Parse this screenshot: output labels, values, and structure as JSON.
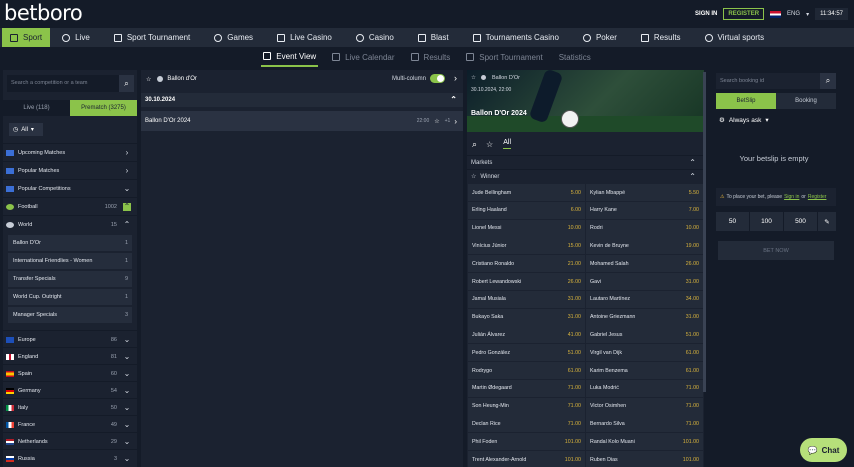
{
  "header": {
    "logo": "betboro",
    "sign_in": "SIGN IN",
    "register": "REGISTER",
    "lang": "ENG",
    "time": "11:34:57"
  },
  "nav": [
    {
      "label": "Sport",
      "icon": "sport-icon"
    },
    {
      "label": "Live",
      "icon": "live-icon"
    },
    {
      "label": "Sport Tournament",
      "icon": "trophy-icon"
    },
    {
      "label": "Games",
      "icon": "games-icon"
    },
    {
      "label": "Live Casino",
      "icon": "casino-icon"
    },
    {
      "label": "Casino",
      "icon": "casino-chip-icon"
    },
    {
      "label": "Blast",
      "icon": "blast-icon"
    },
    {
      "label": "Tournaments Casino",
      "icon": "tournament-icon"
    },
    {
      "label": "Poker",
      "icon": "poker-icon"
    },
    {
      "label": "Results",
      "icon": "results-icon"
    },
    {
      "label": "Virtual sports",
      "icon": "virtual-icon"
    }
  ],
  "subnav": [
    {
      "label": "Event View"
    },
    {
      "label": "Live Calendar"
    },
    {
      "label": "Results"
    },
    {
      "label": "Sport Tournament"
    },
    {
      "label": "Statistics"
    }
  ],
  "left": {
    "search_placeholder": "Search a competition or a team",
    "tab_live": "Live (118)",
    "tab_prematch": "Prematch (3275)",
    "all": "All",
    "rows": [
      {
        "label": "Upcoming Matches",
        "count": ""
      },
      {
        "label": "Popular Matches",
        "count": ""
      },
      {
        "label": "Popular Competitions",
        "count": ""
      },
      {
        "label": "Football",
        "count": "1002"
      },
      {
        "label": "World",
        "count": "15"
      }
    ],
    "world_items": [
      {
        "label": "Ballon D'Or",
        "count": "1"
      },
      {
        "label": "International Friendlies - Women",
        "count": "1"
      },
      {
        "label": "Transfer Specials",
        "count": "9"
      },
      {
        "label": "World Cup. Outright",
        "count": "1"
      },
      {
        "label": "Manager Specials",
        "count": "3"
      }
    ],
    "countries": [
      {
        "label": "Europe",
        "count": "86"
      },
      {
        "label": "England",
        "count": "81"
      },
      {
        "label": "Spain",
        "count": "60"
      },
      {
        "label": "Germany",
        "count": "54"
      },
      {
        "label": "Italy",
        "count": "50"
      },
      {
        "label": "France",
        "count": "49"
      },
      {
        "label": "Netherlands",
        "count": "29"
      },
      {
        "label": "Russia",
        "count": "3"
      }
    ]
  },
  "middle": {
    "title": "Ballon d'Or",
    "multi_column": "Multi-column",
    "date": "30.10.2024",
    "match": "Ballon D'Or 2024",
    "match_time": "22:00",
    "match_more": "+1"
  },
  "event": {
    "breadcrumb": "Ballon D'Or",
    "date": "30.10.2024, 22:00",
    "title": "Ballon D'Or 2024",
    "filter_all": "All",
    "markets": "Markets",
    "winner": "Winner",
    "odds": [
      [
        "Jude Bellingham",
        "5.00",
        "Kylian Mbappé",
        "5.50"
      ],
      [
        "Erling Haaland",
        "6.00",
        "Harry Kane",
        "7.00"
      ],
      [
        "Lionel Messi",
        "10.00",
        "Rodri",
        "10.00"
      ],
      [
        "Vinícius Júnior",
        "15.00",
        "Kevin de Bruyne",
        "19.00"
      ],
      [
        "Cristiano Ronaldo",
        "21.00",
        "Mohamed Salah",
        "26.00"
      ],
      [
        "Robert Lewandowski",
        "26.00",
        "Gavi",
        "31.00"
      ],
      [
        "Jamal Musiala",
        "31.00",
        "Lautaro Martínez",
        "34.00"
      ],
      [
        "Bukayo Saka",
        "31.00",
        "Antoine Griezmann",
        "31.00"
      ],
      [
        "Julián Álvarez",
        "41.00",
        "Gabriel Jesus",
        "51.00"
      ],
      [
        "Pedro González",
        "51.00",
        "Virgil van Dijk",
        "61.00"
      ],
      [
        "Rodrygo",
        "61.00",
        "Karim Benzema",
        "61.00"
      ],
      [
        "Martin Ødegaard",
        "71.00",
        "Luka Modrić",
        "71.00"
      ],
      [
        "Son Heung-Min",
        "71.00",
        "Victor Osimhen",
        "71.00"
      ],
      [
        "Declan Rice",
        "71.00",
        "Bernardo Silva",
        "71.00"
      ],
      [
        "Phil Foden",
        "101.00",
        "Randal Kolo Muani",
        "101.00"
      ],
      [
        "Trent Alexander-Arnold",
        "101.00",
        "Ruben Dias",
        "101.00"
      ]
    ]
  },
  "betslip": {
    "search_placeholder": "Search booking id",
    "tab_betslip": "BetSlip",
    "tab_booking": "Booking",
    "mode": "Always ask",
    "empty": "Your betslip is empty",
    "warn_pre": "To place your bet, please",
    "sign_in": "Sign in",
    "or": "or",
    "register": "Register",
    "stakes": [
      "50",
      "100",
      "500"
    ],
    "bet_now": "BET NOW"
  },
  "chat": "Chat"
}
